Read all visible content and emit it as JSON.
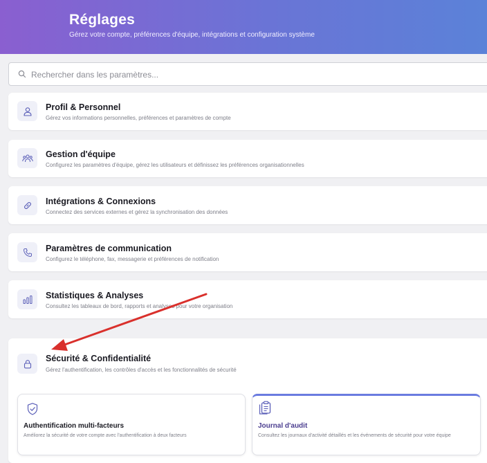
{
  "header": {
    "title": "Réglages",
    "subtitle": "Gérez votre compte, préférences d'équipe, intégrations et configuration système"
  },
  "search": {
    "placeholder": "Rechercher dans les paramètres..."
  },
  "sections": [
    {
      "title": "Profil & Personnel",
      "description": "Gérez vos informations personnelles, préférences et paramètres de compte",
      "icon": "user-icon"
    },
    {
      "title": "Gestion d'équipe",
      "description": "Configurez les paramètres d'équipe, gérez les utilisateurs et définissez les préférences organisationnelles",
      "icon": "team-icon"
    },
    {
      "title": "Intégrations & Connexions",
      "description": "Connectez des services externes et gérez la synchronisation des données",
      "icon": "link-icon"
    },
    {
      "title": "Paramètres de communication",
      "description": "Configurez le téléphone, fax, messagerie et préférences de notification",
      "icon": "phone-icon"
    },
    {
      "title": "Statistiques & Analyses",
      "description": "Consultez les tableaux de bord, rapports et analyses pour votre organisation",
      "icon": "bar-chart-icon"
    }
  ],
  "security": {
    "title": "Sécurité & Confidentialité",
    "description": "Gérez l'authentification, les contrôles d'accès et les fonctionnalités de sécurité",
    "icon": "lock-icon",
    "sub_items": [
      {
        "title": "Authentification multi-facteurs",
        "description": "Améliorez la sécurité de votre compte avec l'authentification à deux facteurs",
        "icon": "shield-check-icon",
        "title_color": "#1a1a22"
      },
      {
        "title": "Journal d'audit",
        "description": "Consultez les journaux d'activité détaillés et les événements de sécurité pour votre équipe",
        "icon": "clipboard-icon",
        "title_color": "#4a3d8f"
      }
    ]
  },
  "colors": {
    "accent": "#6a74d6",
    "icon_stroke": "#5b5fb8",
    "annotation_arrow": "#d9302c"
  }
}
